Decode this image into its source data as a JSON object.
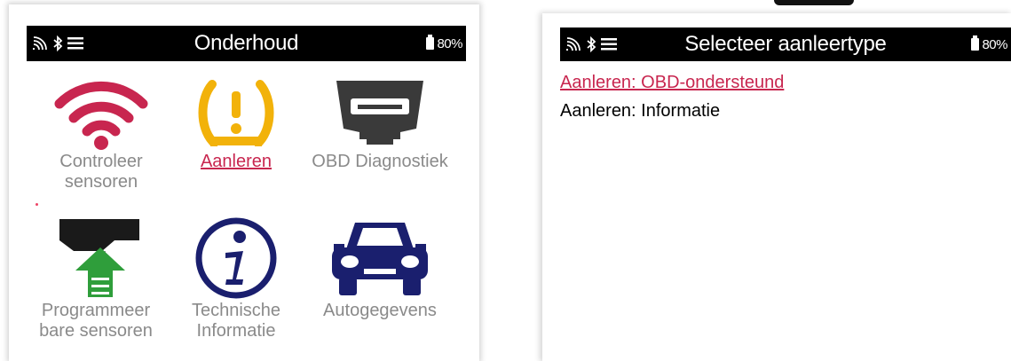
{
  "left_screen": {
    "status": {
      "title": "Onderhoud",
      "battery": "80%"
    },
    "tiles": [
      {
        "label": "Controleer sensoren",
        "icon": "wifi-signal-icon",
        "selected": false
      },
      {
        "label": "Aanleren",
        "icon": "tpms-warning-icon",
        "selected": true
      },
      {
        "label": "OBD Diagnostiek",
        "icon": "obd-connector-icon",
        "selected": false
      },
      {
        "label": "Programmeer bare sensoren",
        "icon": "sensor-upload-icon",
        "selected": false
      },
      {
        "label": "Technische Informatie",
        "icon": "info-icon",
        "selected": false
      },
      {
        "label": "Autogegevens",
        "icon": "car-icon",
        "selected": false
      }
    ]
  },
  "right_screen": {
    "status": {
      "title": "Selecteer aanleertype",
      "battery": "80%"
    },
    "items": [
      {
        "label": "Aanleren: OBD-ondersteund",
        "selected": true
      },
      {
        "label": "Aanleren: Informatie",
        "selected": false
      }
    ]
  },
  "colors": {
    "accent": "#c8264f",
    "wifi": "#c8264f",
    "tpms": "#f2b20a",
    "obd": "#3a3a3a",
    "navy": "#1a1f6e",
    "green": "#2f9e3b",
    "label_gray": "#8a8a8a"
  }
}
